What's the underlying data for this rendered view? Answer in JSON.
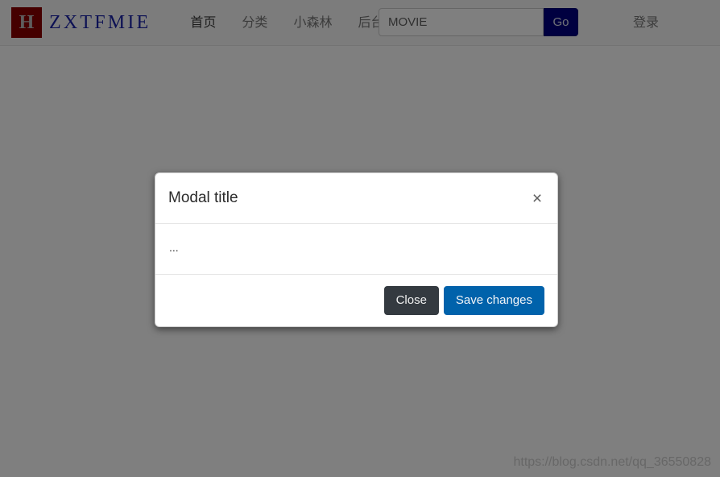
{
  "navbar": {
    "brand": {
      "mark": "H",
      "text": "ZXTFMIE"
    },
    "links": [
      {
        "label": "首页",
        "active": true
      },
      {
        "label": "分类",
        "active": false
      },
      {
        "label": "小森林",
        "active": false
      },
      {
        "label": "后台",
        "active": false
      }
    ],
    "search": {
      "value": "MOVIE",
      "placeholder": "",
      "button_label": "Go"
    },
    "right_links": [
      {
        "label": "登录"
      }
    ]
  },
  "modal": {
    "title": "Modal title",
    "close_icon": "×",
    "body_text": "...",
    "buttons": {
      "close_label": "Close",
      "save_label": "Save changes"
    }
  },
  "watermark": {
    "text": "https://blog.csdn.net/qq_36550828"
  },
  "colors": {
    "brand_mark_bg": "#8b0000",
    "brand_text": "#1a23a8",
    "go_button_bg": "#000080",
    "primary_button_bg": "#0062ab",
    "secondary_button_bg": "#343a40",
    "backdrop": "#000000"
  }
}
